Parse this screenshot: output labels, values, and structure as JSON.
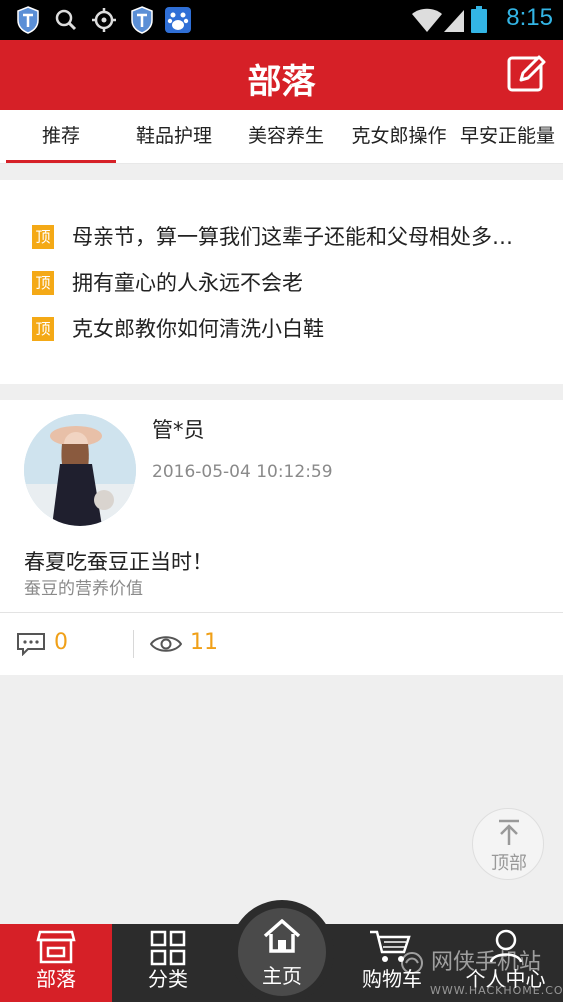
{
  "status_bar": {
    "time": "8:15",
    "left_icons": [
      "shield-icon",
      "search-icon",
      "gps-icon",
      "shield-icon",
      "baidu-paw-icon"
    ],
    "right_icons": [
      "wifi-icon",
      "signal-icon",
      "battery-icon"
    ]
  },
  "header": {
    "title": "部落",
    "edit_icon": "edit-icon"
  },
  "tabs": [
    {
      "label": "推荐",
      "active": true
    },
    {
      "label": "鞋品护理",
      "active": false
    },
    {
      "label": "美容养生",
      "active": false
    },
    {
      "label": "克女郎操作",
      "active": false
    },
    {
      "label": "早安正能量",
      "active": false
    }
  ],
  "pinned": {
    "badge": "顶",
    "items": [
      "母亲节，算一算我们这辈子还能和父母相处多…",
      "拥有童心的人永远不会老",
      "克女郎教你如何清洗小白鞋"
    ]
  },
  "post": {
    "author": "管*员",
    "time": "2016-05-04 10:12:59",
    "title": "春夏吃蚕豆正当时！",
    "subtitle": "蚕豆的营养价值",
    "comments": "0",
    "views": "11"
  },
  "to_top": {
    "label": "顶部"
  },
  "bottom_nav": [
    {
      "label": "部落",
      "icon": "tribe-icon",
      "active": true
    },
    {
      "label": "分类",
      "icon": "category-grid-icon",
      "active": false
    },
    {
      "label": "主页",
      "icon": "home-icon",
      "active": false
    },
    {
      "label": "购物车",
      "icon": "cart-icon",
      "active": false
    },
    {
      "label": "个人中心",
      "icon": "person-icon",
      "active": false
    }
  ],
  "watermark": {
    "text": "网侠手机站",
    "url": "WWW.HACKHOME.COM"
  },
  "colors": {
    "brand_red": "#d62027",
    "accent_orange": "#f0a018",
    "pin_badge": "#f4a916",
    "status_blue": "#33b5e5"
  }
}
